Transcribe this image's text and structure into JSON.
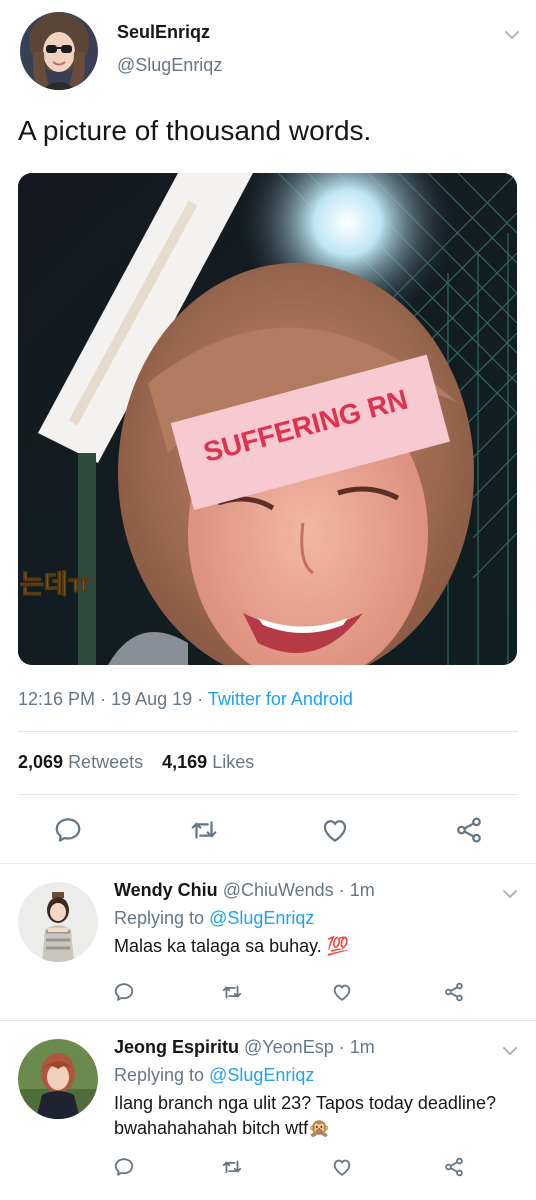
{
  "main_tweet": {
    "display_name": "SeulEnriqz",
    "handle": "@SlugEnriqz",
    "text": "A picture of thousand words.",
    "image_caption_text": "SUFFERING RN",
    "image_subtitle_text": "는데ㅠ",
    "time": "12:16 PM",
    "date": "19 Aug 19",
    "source": "Twitter for Android",
    "retweets_count": "2,069",
    "retweets_label": "Retweets",
    "likes_count": "4,169",
    "likes_label": "Likes",
    "separator": "·"
  },
  "replies": [
    {
      "display_name": "Wendy Chiu",
      "handle": "@ChiuWends",
      "age": "1m",
      "replying_label": "Replying to",
      "replying_to": "@SlugEnriqz",
      "text": "Malas ka talaga sa buhay. 💯"
    },
    {
      "display_name": "Jeong Espiritu",
      "handle": "@YeonEsp",
      "age": "1m",
      "replying_label": "Replying to",
      "replying_to": "@SlugEnriqz",
      "text": "Ilang branch nga ulit 23? Tapos today deadline? bwahahahahah bitch wtf🙊"
    }
  ],
  "icons": [
    "chevron-down-icon",
    "reply-icon",
    "retweet-icon",
    "like-icon",
    "share-icon"
  ],
  "colors": {
    "accent": "#1da1f2",
    "secondary_text": "#657786",
    "divider": "#e1e8ed",
    "caption_red": "#e0314f",
    "caption_bg": "#f7c9d0"
  }
}
